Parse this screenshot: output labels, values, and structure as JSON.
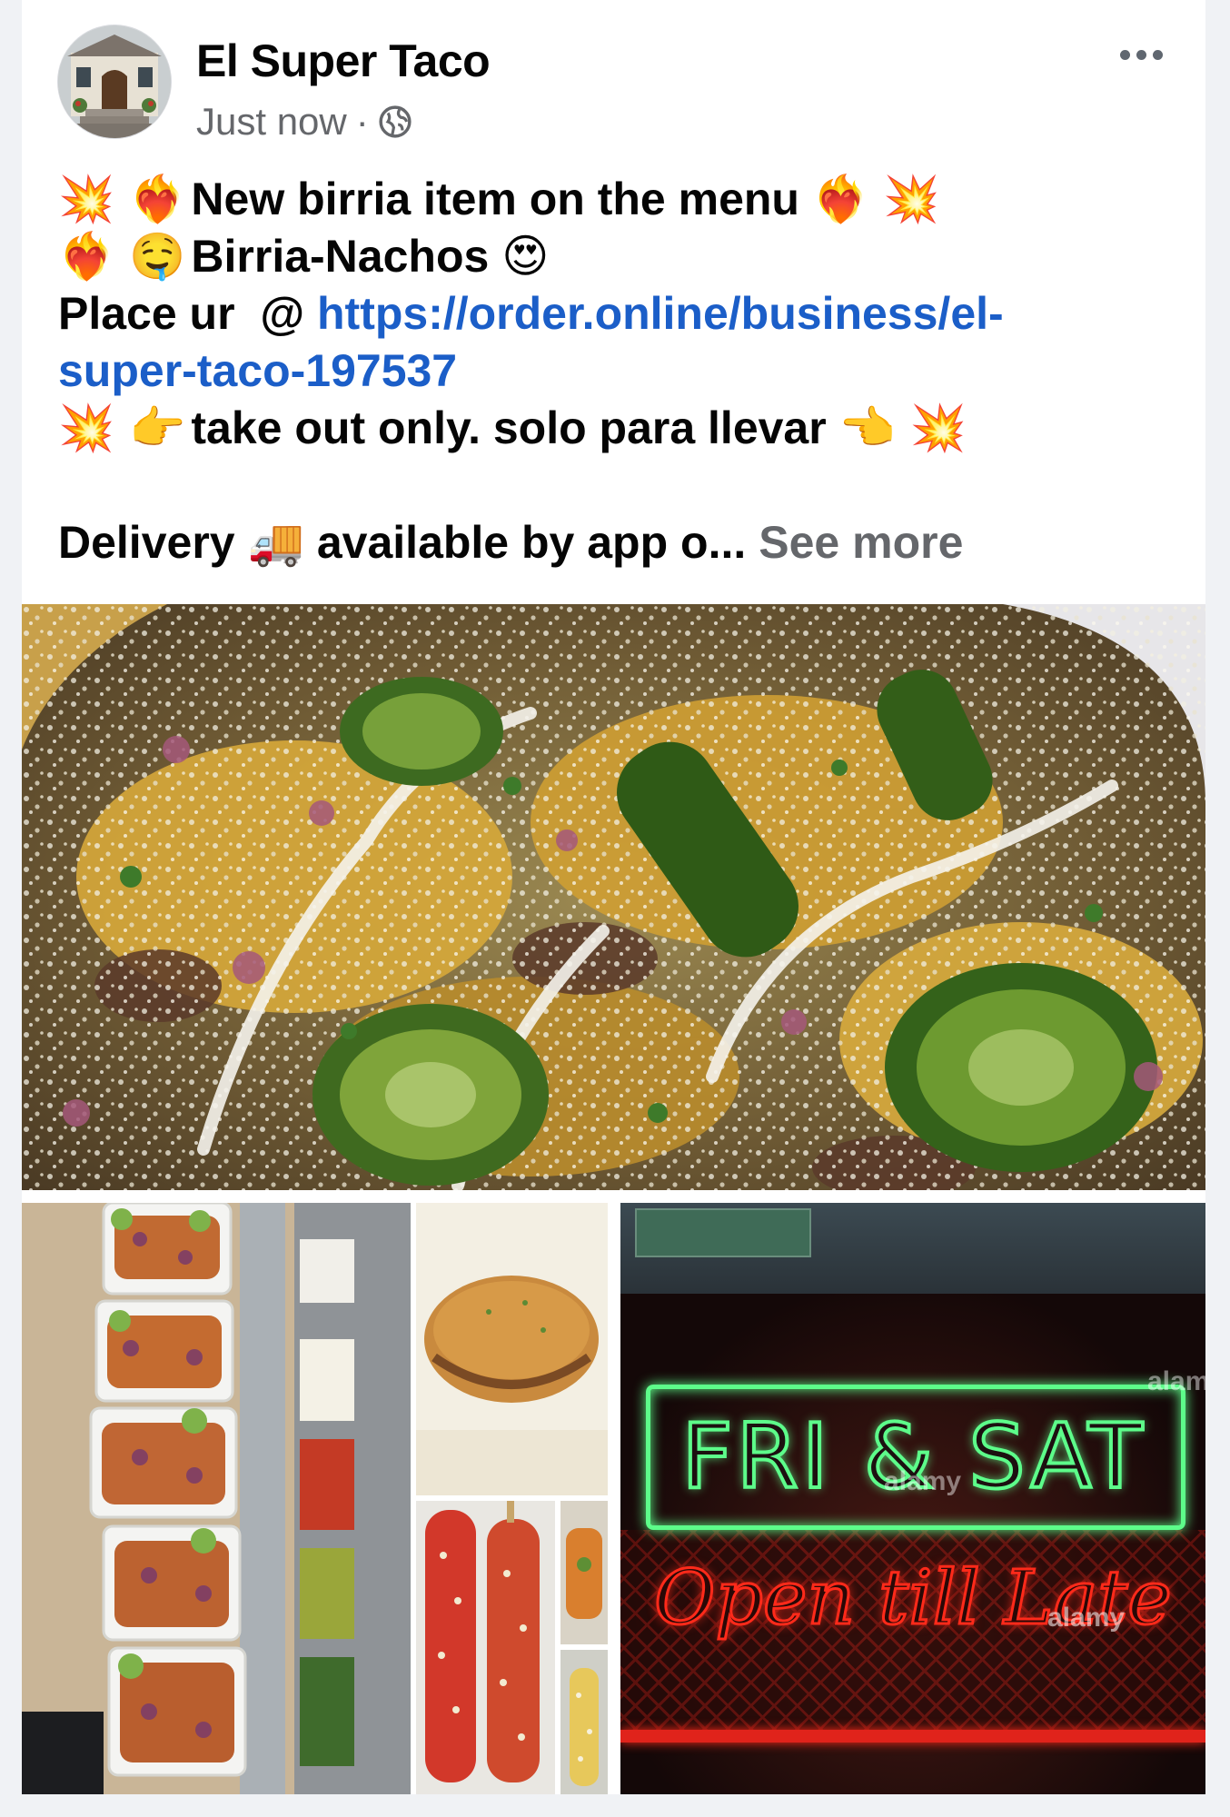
{
  "post": {
    "page_name": "El Super Taco",
    "timestamp": "Just now",
    "separator": "·",
    "audience_icon": "globe-icon",
    "lines": [
      {
        "emoji_before": "💥 ❤️‍🔥",
        "text": "New birria item on the menu",
        "emoji_after": "❤️‍🔥 💥"
      },
      {
        "emoji_before": "❤️‍🔥 🤤",
        "text": "Birria-Nachos",
        "emoji_after": "😍"
      },
      {
        "text": "Place ur  @ ",
        "link": "https://order.online/business/el-"
      },
      {
        "link": "super-taco-197537"
      },
      {
        "emoji_before": "💥 👉",
        "text": "take out only. solo para llevar",
        "emoji_after": "👈 💥"
      },
      {
        "text": ""
      },
      {
        "text": "Delivery",
        "emoji_mid": "🚚",
        "text_after": "available by app o...",
        "see_more": "See more"
      }
    ]
  },
  "photos": {
    "main": "birria-nachos-photo",
    "neon_sign": {
      "line1": "FRI & SAT",
      "line2": "Open till Late",
      "watermark": "alamy"
    }
  },
  "colors": {
    "link": "#1b5ec8",
    "secondary_text": "#65676b",
    "neon_green": "#5dfc8a",
    "neon_red": "#ff2a1a"
  }
}
